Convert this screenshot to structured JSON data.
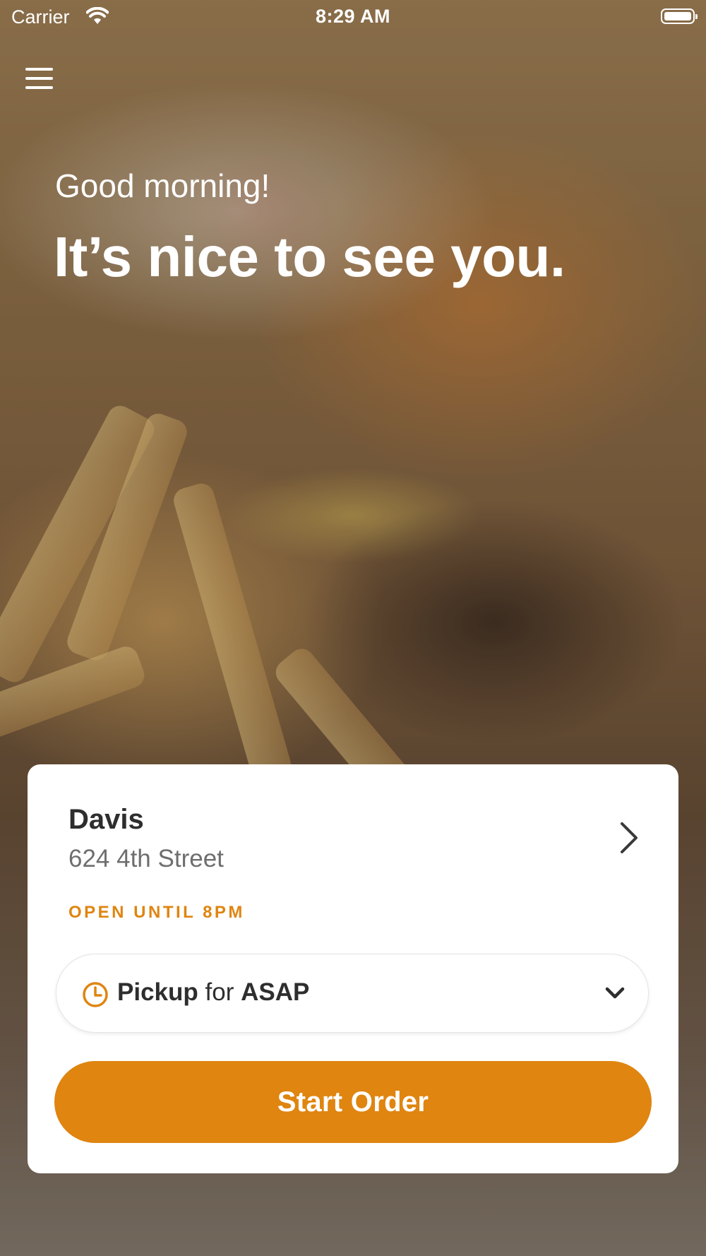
{
  "status_bar": {
    "carrier": "Carrier",
    "time": "8:29 AM",
    "wifi_icon": "wifi-icon",
    "battery_icon": "battery-icon"
  },
  "header": {
    "menu_icon": "hamburger-menu-icon"
  },
  "hero": {
    "greeting": "Good morning!",
    "headline": "It’s nice to see you."
  },
  "location_card": {
    "name": "Davis",
    "address": "624 4th Street",
    "hours_status": "OPEN UNTIL 8PM",
    "order_type": {
      "mode": "Pickup",
      "connector": "for",
      "time": "ASAP",
      "icon": "clock-icon"
    },
    "start_order_label": "Start Order"
  },
  "colors": {
    "accent": "#df8510",
    "text_primary": "#2e2e2e",
    "text_secondary": "#6e6e6e"
  }
}
